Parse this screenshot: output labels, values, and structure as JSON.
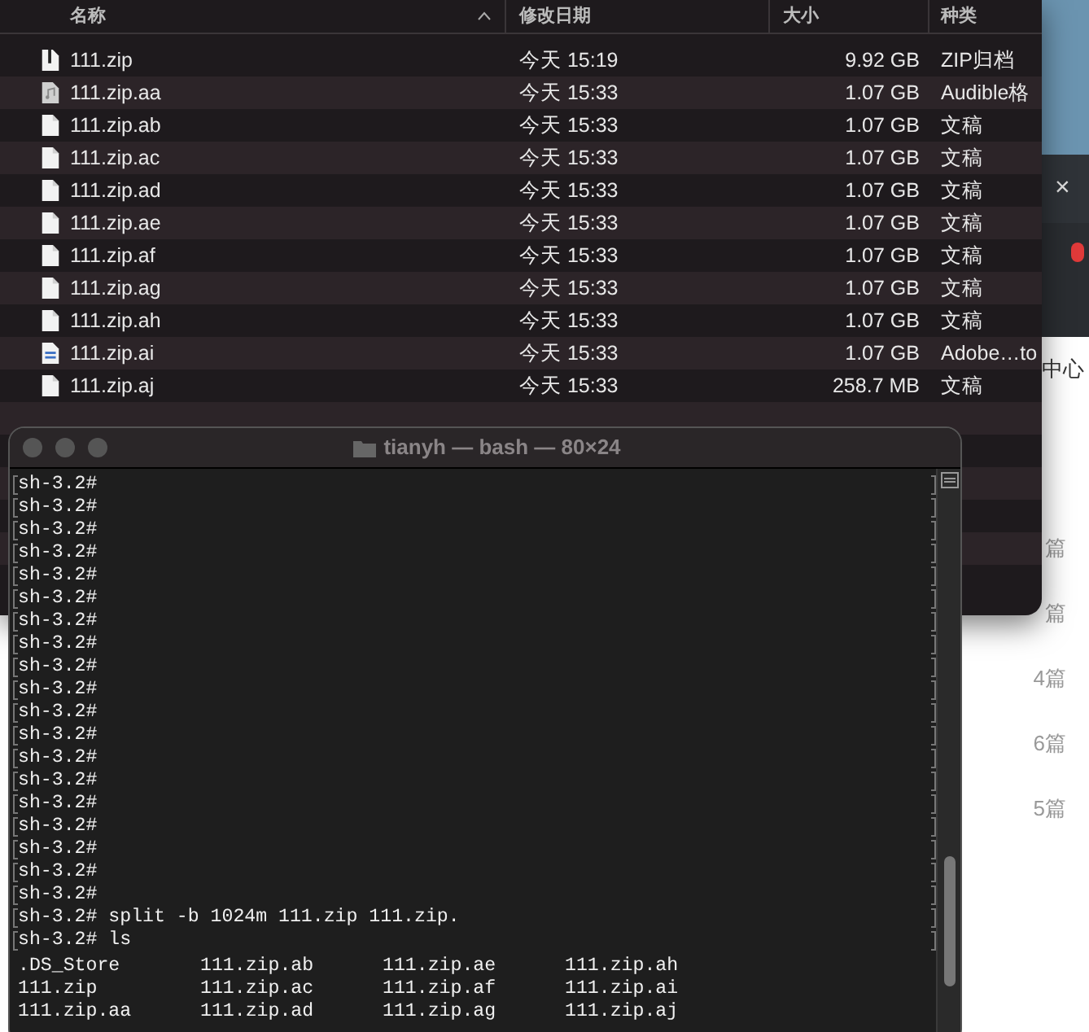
{
  "finder": {
    "columns": [
      {
        "label": "名称",
        "sorted": true
      },
      {
        "label": "修改日期",
        "sorted": false
      },
      {
        "label": "大小",
        "sorted": false
      },
      {
        "label": "种类",
        "sorted": false
      }
    ],
    "rows": [
      {
        "kind": "zip",
        "name": "111.zip",
        "date": "今天 15:19",
        "size": "9.92 GB",
        "type": "ZIP归档"
      },
      {
        "kind": "audio",
        "name": "111.zip.aa",
        "date": "今天 15:33",
        "size": "1.07 GB",
        "type": "Audible格"
      },
      {
        "kind": "doc",
        "name": "111.zip.ab",
        "date": "今天 15:33",
        "size": "1.07 GB",
        "type": "文稿"
      },
      {
        "kind": "doc",
        "name": "111.zip.ac",
        "date": "今天 15:33",
        "size": "1.07 GB",
        "type": "文稿"
      },
      {
        "kind": "doc",
        "name": "111.zip.ad",
        "date": "今天 15:33",
        "size": "1.07 GB",
        "type": "文稿"
      },
      {
        "kind": "doc",
        "name": "111.zip.ae",
        "date": "今天 15:33",
        "size": "1.07 GB",
        "type": "文稿"
      },
      {
        "kind": "doc",
        "name": "111.zip.af",
        "date": "今天 15:33",
        "size": "1.07 GB",
        "type": "文稿"
      },
      {
        "kind": "doc",
        "name": "111.zip.ag",
        "date": "今天 15:33",
        "size": "1.07 GB",
        "type": "文稿"
      },
      {
        "kind": "doc",
        "name": "111.zip.ah",
        "date": "今天 15:33",
        "size": "1.07 GB",
        "type": "文稿"
      },
      {
        "kind": "image",
        "name": "111.zip.ai",
        "date": "今天 15:33",
        "size": "1.07 GB",
        "type": "Adobe…to"
      },
      {
        "kind": "doc",
        "name": "111.zip.aj",
        "date": "今天 15:33",
        "size": "258.7 MB",
        "type": "文稿"
      }
    ]
  },
  "background_page": {
    "close": "×",
    "heading": "中心",
    "counts": [
      "篇",
      "篇",
      "4篇",
      "6篇",
      "5篇"
    ]
  },
  "terminal": {
    "title": "tianyh — bash — 80×24",
    "lines": [
      {
        "kind": "prompt",
        "text": "sh-3.2#"
      },
      {
        "kind": "prompt",
        "text": "sh-3.2#"
      },
      {
        "kind": "prompt",
        "text": "sh-3.2#"
      },
      {
        "kind": "prompt",
        "text": "sh-3.2#"
      },
      {
        "kind": "prompt",
        "text": "sh-3.2#"
      },
      {
        "kind": "prompt",
        "text": "sh-3.2#"
      },
      {
        "kind": "prompt",
        "text": "sh-3.2#"
      },
      {
        "kind": "prompt",
        "text": "sh-3.2#"
      },
      {
        "kind": "prompt",
        "text": "sh-3.2#"
      },
      {
        "kind": "prompt",
        "text": "sh-3.2#"
      },
      {
        "kind": "prompt",
        "text": "sh-3.2#"
      },
      {
        "kind": "prompt",
        "text": "sh-3.2#"
      },
      {
        "kind": "prompt",
        "text": "sh-3.2#"
      },
      {
        "kind": "prompt",
        "text": "sh-3.2#"
      },
      {
        "kind": "prompt",
        "text": "sh-3.2#"
      },
      {
        "kind": "prompt",
        "text": "sh-3.2#"
      },
      {
        "kind": "prompt",
        "text": "sh-3.2#"
      },
      {
        "kind": "prompt",
        "text": "sh-3.2#"
      },
      {
        "kind": "prompt",
        "text": "sh-3.2#"
      },
      {
        "kind": "prompt",
        "text": "sh-3.2# split -b 1024m 111.zip 111.zip."
      },
      {
        "kind": "prompt",
        "text": "sh-3.2# ls"
      },
      {
        "kind": "output",
        "cells": [
          ".DS_Store",
          "111.zip.ab",
          "111.zip.ae",
          "111.zip.ah"
        ]
      },
      {
        "kind": "output",
        "cells": [
          "111.zip",
          "111.zip.ac",
          "111.zip.af",
          "111.zip.ai"
        ]
      },
      {
        "kind": "output",
        "cells": [
          "111.zip.aa",
          "111.zip.ad",
          "111.zip.ag",
          "111.zip.aj"
        ]
      }
    ]
  }
}
